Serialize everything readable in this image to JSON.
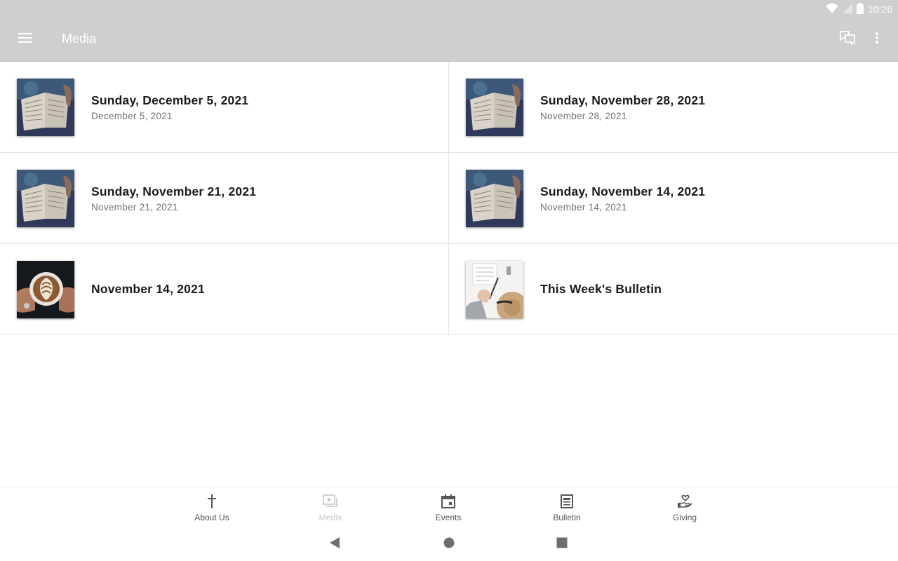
{
  "status": {
    "time": "10:26"
  },
  "appbar": {
    "title": "Media"
  },
  "items": [
    {
      "title": "Sunday, December 5, 2021",
      "subtitle": "December 5, 2021",
      "thumb": "bible"
    },
    {
      "title": "Sunday, November 28, 2021",
      "subtitle": "November 28, 2021",
      "thumb": "bible"
    },
    {
      "title": "Sunday, November 21, 2021",
      "subtitle": "November 21, 2021",
      "thumb": "bible"
    },
    {
      "title": "Sunday, November 14, 2021",
      "subtitle": "November 14, 2021",
      "thumb": "bible"
    },
    {
      "title": "November 14, 2021",
      "subtitle": "",
      "thumb": "coffee"
    },
    {
      "title": "This Week's Bulletin",
      "subtitle": "",
      "thumb": "bulletin"
    }
  ],
  "bottom_nav": [
    {
      "label": "About Us",
      "icon": "cross-icon",
      "active": false
    },
    {
      "label": "Media",
      "icon": "media-icon",
      "active": true
    },
    {
      "label": "Events",
      "icon": "calendar-icon",
      "active": false
    },
    {
      "label": "Bulletin",
      "icon": "bulletin-icon",
      "active": false
    },
    {
      "label": "Giving",
      "icon": "giving-icon",
      "active": false
    }
  ],
  "colors": {
    "appbar": "#cfcfcf",
    "active_tab": "#c8c8c8"
  }
}
